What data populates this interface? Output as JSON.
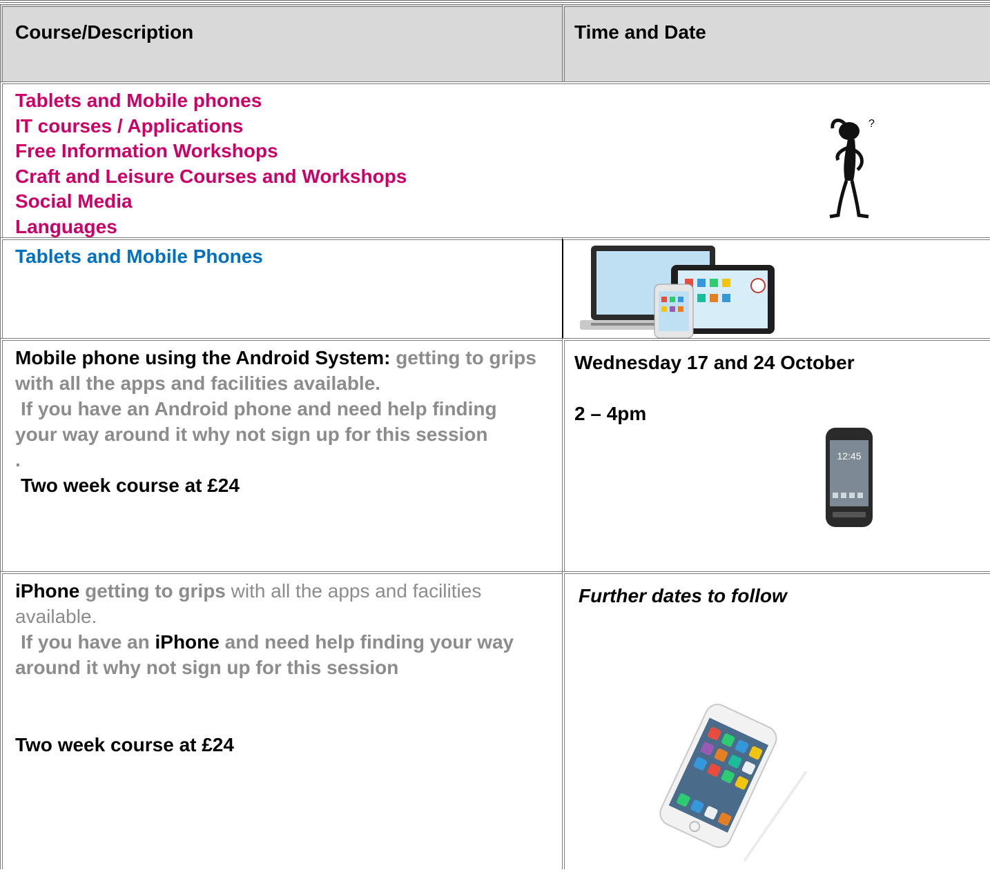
{
  "table": {
    "headers": {
      "course": "Course/Description",
      "time": "Time and Date"
    },
    "categories": [
      "Tablets and Mobile phones",
      "IT courses / Applications",
      "Free Information Workshops",
      "Craft and Leisure Courses and Workshops",
      "Social Media",
      "Languages"
    ],
    "section_heading": "Tablets and Mobile Phones",
    "android": {
      "title": "Mobile phone using the Android System:",
      "intro": "getting to grips with all the apps and facilities available.",
      "body": "If you have an Android phone and need help finding your way around it why not sign  up for this session",
      "dot": ".",
      "price": "Two week course at £24",
      "date": "Wednesday 17 and 24 October",
      "time": "2 – 4pm"
    },
    "iphone": {
      "title": "iPhone",
      "grips": "getting to grips",
      "rest": "with all the apps and facilities available.",
      "body_pre": "If you have an",
      "body_brand": "iPhone",
      "body_post": "and need help finding your way around it why not sign  up for this session",
      "price": "Two week course at £24",
      "date": "Further dates to follow"
    }
  },
  "phone_screen_time": "12:45"
}
